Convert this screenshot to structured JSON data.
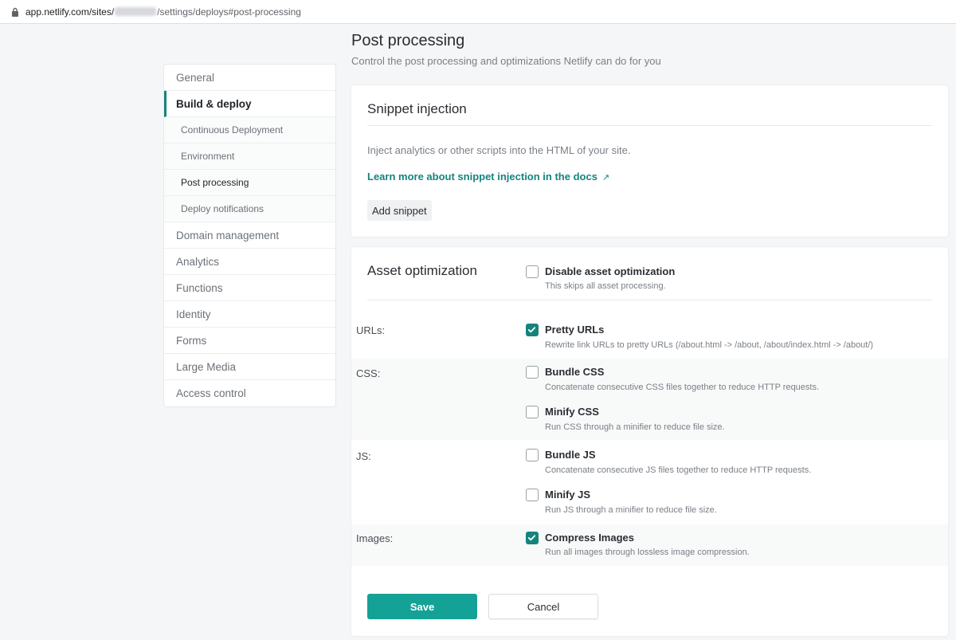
{
  "browser": {
    "url_prefix": "app.netlify.com/sites/",
    "url_suffix": "/settings/deploys#post-processing"
  },
  "sidebar": {
    "items": [
      {
        "label": "General"
      },
      {
        "label": "Build & deploy",
        "active": true
      },
      {
        "label": "Continuous Deployment",
        "sub": true
      },
      {
        "label": "Environment",
        "sub": true
      },
      {
        "label": "Post processing",
        "sub": true,
        "current": true
      },
      {
        "label": "Deploy notifications",
        "sub": true
      },
      {
        "label": "Domain management"
      },
      {
        "label": "Analytics"
      },
      {
        "label": "Functions"
      },
      {
        "label": "Identity"
      },
      {
        "label": "Forms"
      },
      {
        "label": "Large Media"
      },
      {
        "label": "Access control"
      }
    ]
  },
  "header": {
    "title": "Post processing",
    "subtitle": "Control the post processing and optimizations Netlify can do for you"
  },
  "snippet": {
    "title": "Snippet injection",
    "description": "Inject analytics or other scripts into the HTML of your site.",
    "link": "Learn more about snippet injection in the docs",
    "link_icon": "external-link-icon",
    "button": "Add snippet"
  },
  "assets": {
    "title": "Asset optimization",
    "disable": {
      "label": "Disable asset optimization",
      "desc": "This skips all asset processing.",
      "checked": false
    },
    "urls_label": "URLs:",
    "pretty_urls": {
      "label": "Pretty URLs",
      "desc": "Rewrite link URLs to pretty URLs (/about.html -> /about, /about/index.html -> /about/)",
      "checked": true
    },
    "css_label": "CSS:",
    "bundle_css": {
      "label": "Bundle CSS",
      "desc": "Concatenate consecutive CSS files together to reduce HTTP requests.",
      "checked": false
    },
    "minify_css": {
      "label": "Minify CSS",
      "desc": "Run CSS through a minifier to reduce file size.",
      "checked": false
    },
    "js_label": "JS:",
    "bundle_js": {
      "label": "Bundle JS",
      "desc": "Concatenate consecutive JS files together to reduce HTTP requests.",
      "checked": false
    },
    "minify_js": {
      "label": "Minify JS",
      "desc": "Run JS through a minifier to reduce file size.",
      "checked": false
    },
    "images_label": "Images:",
    "compress_images": {
      "label": "Compress Images",
      "desc": "Run all images through lossless image compression.",
      "checked": true
    }
  },
  "actions": {
    "save": "Save",
    "cancel": "Cancel"
  },
  "colors": {
    "accent": "#15847d",
    "save_button": "#15a296"
  }
}
